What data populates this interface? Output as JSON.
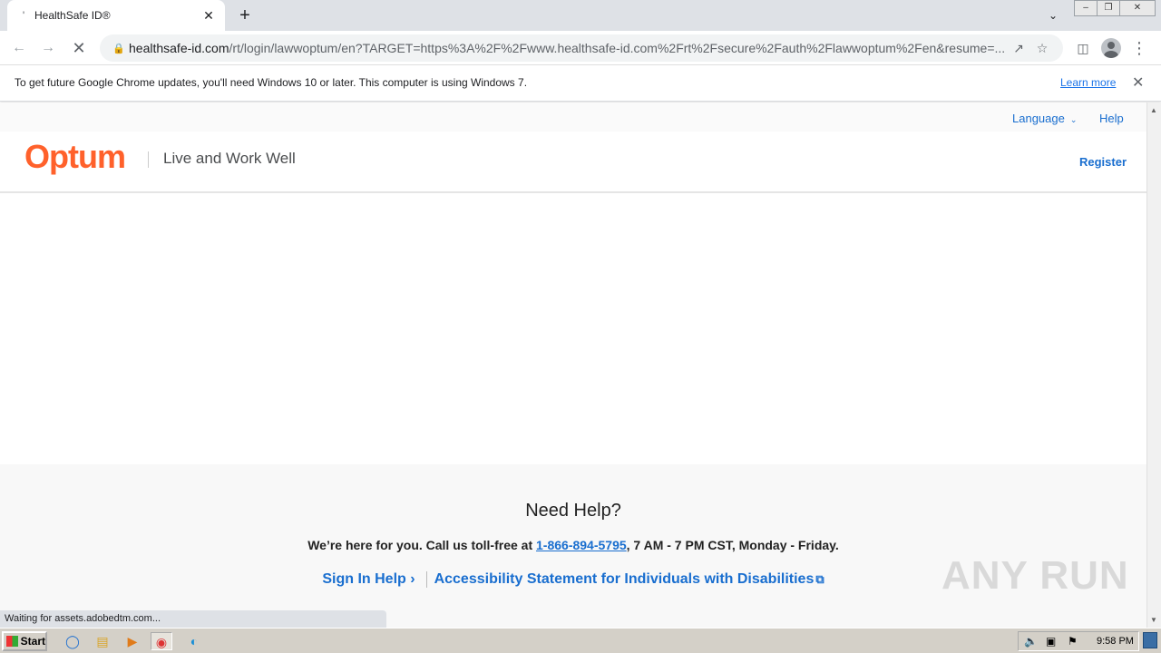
{
  "browser": {
    "tab_title": "HealthSafe ID®",
    "tab_close": "✕",
    "new_tab": "+",
    "url_host": "healthsafe-id.com",
    "url_path": "/rt/login/lawwoptum/en?TARGET=https%3A%2F%2Fwww.healthsafe-id.com%2Frt%2Fsecure%2Fauth%2Flawwoptum%2Fen&resume=...",
    "infobar_message": "To get future Google Chrome updates, you'll need Windows 10 or later. This computer is using Windows 7.",
    "infobar_link": "Learn more",
    "status_text": "Waiting for assets.adobedtm.com..."
  },
  "site": {
    "language": "Language",
    "help": "Help",
    "logo": "Optum",
    "tagline": "Live and Work Well",
    "register": "Register"
  },
  "footer": {
    "heading": "Need Help?",
    "call_prefix": "We’re here for you. Call us toll-free at ",
    "phone": "1-866-894-5795",
    "call_suffix": ", 7 AM - 7 PM CST, Monday - Friday.",
    "sign_in_help": "Sign In Help",
    "accessibility": "Accessibility Statement for Individuals with Disabilities"
  },
  "watermark": "ANY RUN",
  "taskbar": {
    "start": "Start",
    "clock": "9:58 PM"
  },
  "colors": {
    "brand": "#ff612b",
    "link": "#196ecf"
  }
}
